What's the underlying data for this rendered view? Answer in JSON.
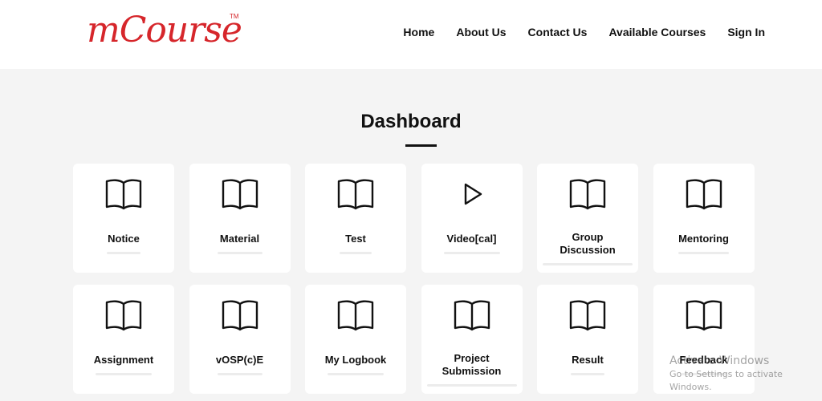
{
  "header": {
    "logo": "mCourse",
    "logo_tm": "TM",
    "nav": [
      "Home",
      "About Us",
      "Contact Us",
      "Available Courses",
      "Sign In"
    ]
  },
  "main": {
    "title": "Dashboard",
    "cards": [
      {
        "label": "Notice",
        "icon": "book-icon"
      },
      {
        "label": "Material",
        "icon": "book-icon"
      },
      {
        "label": "Test",
        "icon": "book-icon"
      },
      {
        "label": "Video[cal]",
        "icon": "play-icon"
      },
      {
        "label": "Group Discussion",
        "icon": "book-icon"
      },
      {
        "label": "Mentoring",
        "icon": "book-icon"
      },
      {
        "label": "Assignment",
        "icon": "book-icon"
      },
      {
        "label": "vOSP(c)E",
        "icon": "book-icon"
      },
      {
        "label": "My Logbook",
        "icon": "book-icon"
      },
      {
        "label": "Project Submission",
        "icon": "book-icon"
      },
      {
        "label": "Result",
        "icon": "book-icon"
      },
      {
        "label": "Feedback",
        "icon": "book-icon"
      }
    ]
  },
  "watermark": {
    "line1": "Activate Windows",
    "line2": "Go to Settings to activate Windows."
  }
}
